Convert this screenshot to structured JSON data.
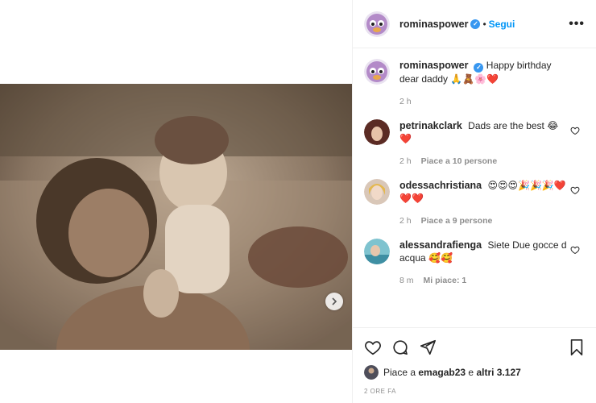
{
  "post": {
    "username": "rominaspower",
    "verified_mark": "✓",
    "dot": "•",
    "follow_label": "Segui",
    "more_label": "•••",
    "caption_text": "Happy birthday dear daddy",
    "caption_emoji": "🙏🧸🌸❤️",
    "caption_time": "2 h"
  },
  "comments": [
    {
      "username": "petrinakclark",
      "text": "Dads are the best",
      "emoji": "😂❤️",
      "time": "2 h",
      "likes": "Piace a 10 persone"
    },
    {
      "username": "odessachristiana",
      "text": "",
      "emoji": "😍😍😍🎉🎉🎉❤️❤️❤️",
      "time": "2 h",
      "likes": "Piace a 9 persone"
    },
    {
      "username": "alessandrafienga",
      "text": "Siete Due gocce d acqua",
      "emoji": "🥰🥰",
      "time": "8 m",
      "likes": "Mi piace: 1"
    }
  ],
  "footer": {
    "liked_prefix": "Piace a",
    "liked_user": "emagab23",
    "liked_and": "e",
    "liked_others": "altri 3.127",
    "timestamp": "2 ORE FA"
  },
  "icons": {
    "like": "heart-icon",
    "comment": "comment-icon",
    "share": "share-icon",
    "save": "bookmark-icon",
    "next": "chevron-right-icon"
  },
  "colors": {
    "link": "#0095f6",
    "verified": "#3897f0",
    "muted": "#8e8e8e",
    "text": "#262626"
  }
}
